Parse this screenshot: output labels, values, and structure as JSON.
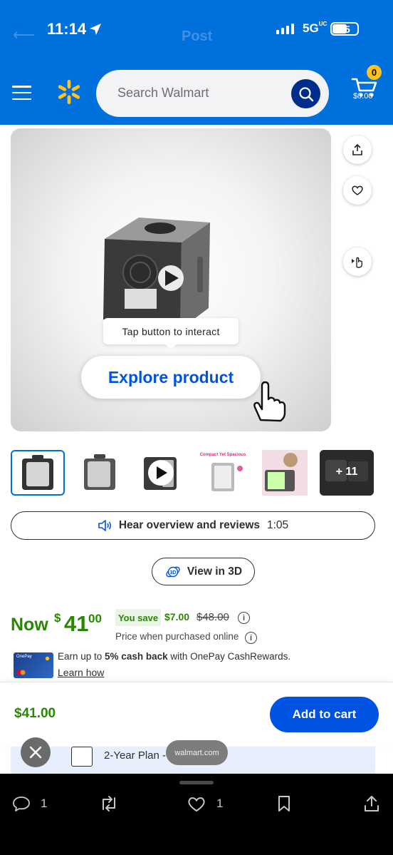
{
  "status_bar": {
    "time": "11:14",
    "network": "5G",
    "network_badge": "UC",
    "battery": "35",
    "ghost_title": "Post"
  },
  "header": {
    "search_placeholder": "Search Walmart",
    "cart_count": "0",
    "cart_total": "$0.00",
    "brand_color": "#0071dc",
    "spark_color": "#ffc220"
  },
  "media": {
    "tooltip": "Tap button to interact",
    "explore_label": "Explore product"
  },
  "thumbnails": [
    {
      "label": ""
    },
    {
      "label": ""
    },
    {
      "label": ""
    },
    {
      "label": "Compact Yet Spacious"
    },
    {
      "label": ""
    },
    {
      "label": "+ 11"
    }
  ],
  "audio": {
    "label": "Hear overview and reviews",
    "duration": "1:05"
  },
  "view3d": {
    "label": "View in 3D",
    "badge": "3D"
  },
  "price": {
    "now_label": "Now",
    "currency": "$",
    "whole": "41",
    "cents": "00",
    "you_save_label": "You save",
    "save_amount": "$7.00",
    "was_price": "$48.00",
    "online_note": "Price when purchased online"
  },
  "onepay": {
    "text_prefix": "Earn up to ",
    "text_bold": "5% cash back",
    "text_suffix": " with OnePay CashRewards.",
    "learn_how": "Learn how",
    "card_label": "OnePay"
  },
  "sticky": {
    "price": "$41.00",
    "add_to_cart": "Add to cart"
  },
  "plan": {
    "label": "2-Year Plan -"
  },
  "browser": {
    "url": "walmart.com"
  },
  "bottom_bar": {
    "replies": "1",
    "likes": "1"
  }
}
